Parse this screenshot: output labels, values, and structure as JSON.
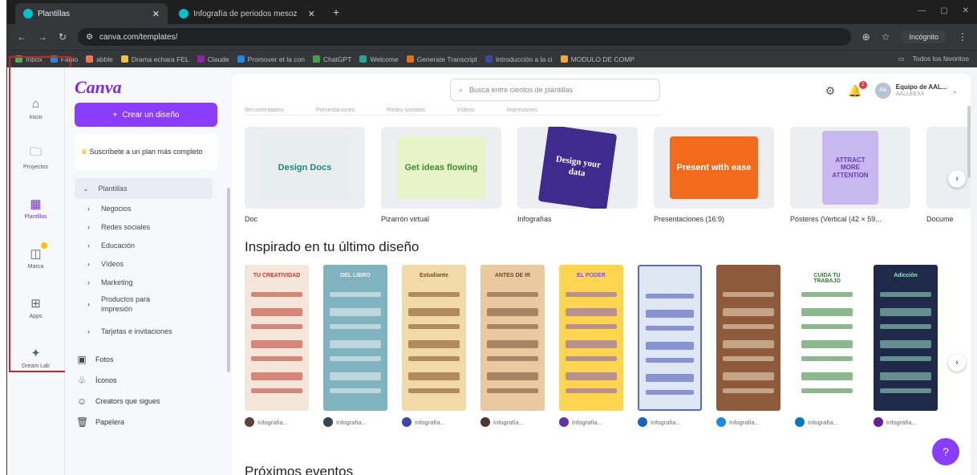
{
  "browser": {
    "tabs": [
      {
        "title": "Plantillas",
        "active": true
      },
      {
        "title": "Infografía de periodos mesoz",
        "active": false
      }
    ],
    "url": "canva.com/templates/",
    "profile_label": "Incógnito",
    "bookmarks": [
      "Inbox",
      "Fabio",
      "abble",
      "Drama echara FEL",
      "Claude",
      "Promover et la con",
      "ChatGPT",
      "Welcome",
      "Generate Transcript",
      "Introducción a la ci",
      "MODULO DE COMP"
    ],
    "bookmarks_right": "Todos los favoritos"
  },
  "rail": [
    {
      "icon": "home-icon",
      "glyph": "⌂",
      "label": "Inicio",
      "active": false
    },
    {
      "icon": "folder-icon",
      "glyph": "🗀",
      "label": "Proyectos",
      "active": false
    },
    {
      "icon": "templates-icon",
      "glyph": "▦",
      "label": "Plantillas",
      "active": true
    },
    {
      "icon": "brand-icon",
      "glyph": "◫",
      "label": "Marca",
      "active": false,
      "dot": true
    },
    {
      "icon": "apps-icon",
      "glyph": "⊞",
      "label": "Apps",
      "active": false
    },
    {
      "icon": "dream-lab-icon",
      "glyph": "✦",
      "label": "Dream Lab",
      "active": false
    }
  ],
  "panel": {
    "logo": "Canva",
    "create_button": "Crear un diseño",
    "subscribe_text": "Suscríbete a un plan más completo",
    "templates_heading": "Plantillas",
    "tree": [
      "Negocios",
      "Redes sociales",
      "Educación",
      "Vídeos",
      "Marketing",
      "Productos para impresión",
      "Tarjetas e invitaciones"
    ],
    "links": [
      {
        "icon": "photo-icon",
        "glyph": "▣",
        "label": "Fotos"
      },
      {
        "icon": "shapes-icon",
        "glyph": "♧",
        "label": "Íconos"
      },
      {
        "icon": "creators-icon",
        "glyph": "☺",
        "label": "Creators que sigues"
      },
      {
        "icon": "trash-icon",
        "glyph": "🗑",
        "label": "Papelera"
      }
    ]
  },
  "topbar": {
    "search_placeholder": "Busca entre cientos de plantillas",
    "notifications_count": "2",
    "team_name": "Equipo de AAL...",
    "team_sub": "AALLEEXX",
    "team_initials": "AA"
  },
  "category_strip": [
    "Recomendados",
    "Presentaciones",
    "Redes sociales",
    "Vídeos",
    "Impresiones"
  ],
  "design_types": [
    {
      "label": "Doc",
      "thumb_text": "Design Docs",
      "bg": "#e6eef0",
      "accent": "#1b8a7a"
    },
    {
      "label": "Pizarrón virtual",
      "thumb_text": "Get ideas flowing",
      "bg": "#e9f3c8",
      "accent": "#3a8f3a"
    },
    {
      "label": "Infografías",
      "thumb_text": "Design your data",
      "bg": "#3d2b8e",
      "accent": "#ffffff"
    },
    {
      "label": "Presentaciones (16:9)",
      "thumb_text": "Present with ease",
      "bg": "#f26a1b",
      "accent": "#ffffff"
    },
    {
      "label": "Pósteres (Vertical (42 × 59...",
      "thumb_text": "ATTRACT MORE ATTENTION",
      "bg": "#c9b8f0",
      "accent": "#6a3cc0"
    },
    {
      "label": "Docume",
      "thumb_text": "",
      "bg": "#f1eef8",
      "accent": "#8b3dff"
    }
  ],
  "section_title": "Inspirado en tu último diseño",
  "recent_designs": [
    {
      "label": "Infografía...",
      "bg": "#f4e6d9",
      "accent": "#c0392b",
      "owner_color": "#5d4037",
      "title_text": "TU CREATIVIDAD"
    },
    {
      "label": "Infografía...",
      "bg": "#7fb3c0",
      "accent": "#f1f1f1",
      "owner_color": "#37474f",
      "title_text": "DEL LIBRO"
    },
    {
      "label": "Infografía...",
      "bg": "#f1d9a8",
      "accent": "#7a4a1e",
      "owner_color": "#3949ab",
      "title_text": "Estudiante"
    },
    {
      "label": "Infografía...",
      "bg": "#e8c9a0",
      "accent": "#6d4c2f",
      "owner_color": "#4e342e",
      "title_text": "ANTES DE IR"
    },
    {
      "label": "Infografía...",
      "bg": "#ffd54f",
      "accent": "#7e57c2",
      "owner_color": "#5e35b1",
      "title_text": "EL PODER"
    },
    {
      "label": "Infografía...",
      "bg": "#dfe7f5",
      "accent": "#3f51b5",
      "owner_color": "#1565c0",
      "title_text": ""
    },
    {
      "label": "Infografía...",
      "bg": "#8d5a3b",
      "accent": "#f3e0c4",
      "owner_color": "#1e88e5",
      "title_text": ""
    },
    {
      "label": "Infografía...",
      "bg": "#ffffff",
      "accent": "#2e7d32",
      "owner_color": "#0277bd",
      "title_text": "CUIDA TU TRABAJO"
    },
    {
      "label": "Infografía...",
      "bg": "#1f2a4a",
      "accent": "#9fe0c8",
      "owner_color": "#6a1b9a",
      "title_text": "Adicción"
    }
  ],
  "next_section_title": "Próximos eventos",
  "help_label": "?"
}
